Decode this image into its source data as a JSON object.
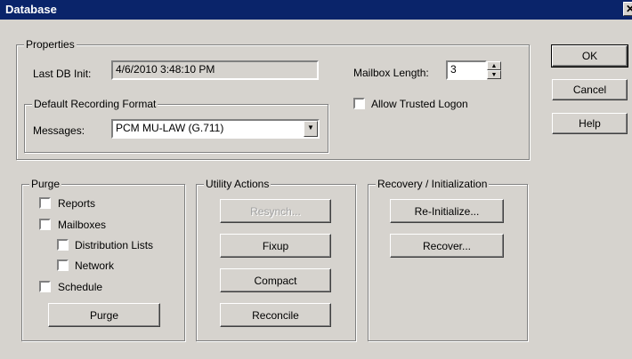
{
  "window": {
    "title": "Database",
    "close_glyph": "✕"
  },
  "properties": {
    "group_label": "Properties",
    "last_db_init_label": "Last DB Init:",
    "last_db_init_value": "4/6/2010 3:48:10 PM",
    "mailbox_length_label": "Mailbox Length:",
    "mailbox_length_value": "3",
    "allow_trusted_logon_label": "Allow Trusted Logon",
    "allow_trusted_logon_checked": false,
    "recording_format": {
      "group_label": "Default Recording Format",
      "messages_label": "Messages:",
      "messages_value": "PCM MU-LAW (G.711)"
    }
  },
  "dialog_buttons": {
    "ok": "OK",
    "cancel": "Cancel",
    "help": "Help"
  },
  "purge": {
    "group_label": "Purge",
    "items": [
      {
        "label": "Reports",
        "checked": false
      },
      {
        "label": "Mailboxes",
        "checked": false
      },
      {
        "label": "Distribution Lists",
        "checked": false
      },
      {
        "label": "Network",
        "checked": false
      },
      {
        "label": "Schedule",
        "checked": false
      }
    ],
    "purge_button": "Purge"
  },
  "utility_actions": {
    "group_label": "Utility Actions",
    "resynch": "Resynch...",
    "fixup": "Fixup",
    "compact": "Compact",
    "reconcile": "Reconcile"
  },
  "recovery": {
    "group_label": "Recovery / Initialization",
    "reinitialize": "Re-Initialize...",
    "recover": "Recover..."
  },
  "icons": {
    "dropdown": "chevron-down-icon",
    "spin_up": "spin-up-icon",
    "spin_down": "spin-down-icon",
    "close": "close-icon"
  }
}
